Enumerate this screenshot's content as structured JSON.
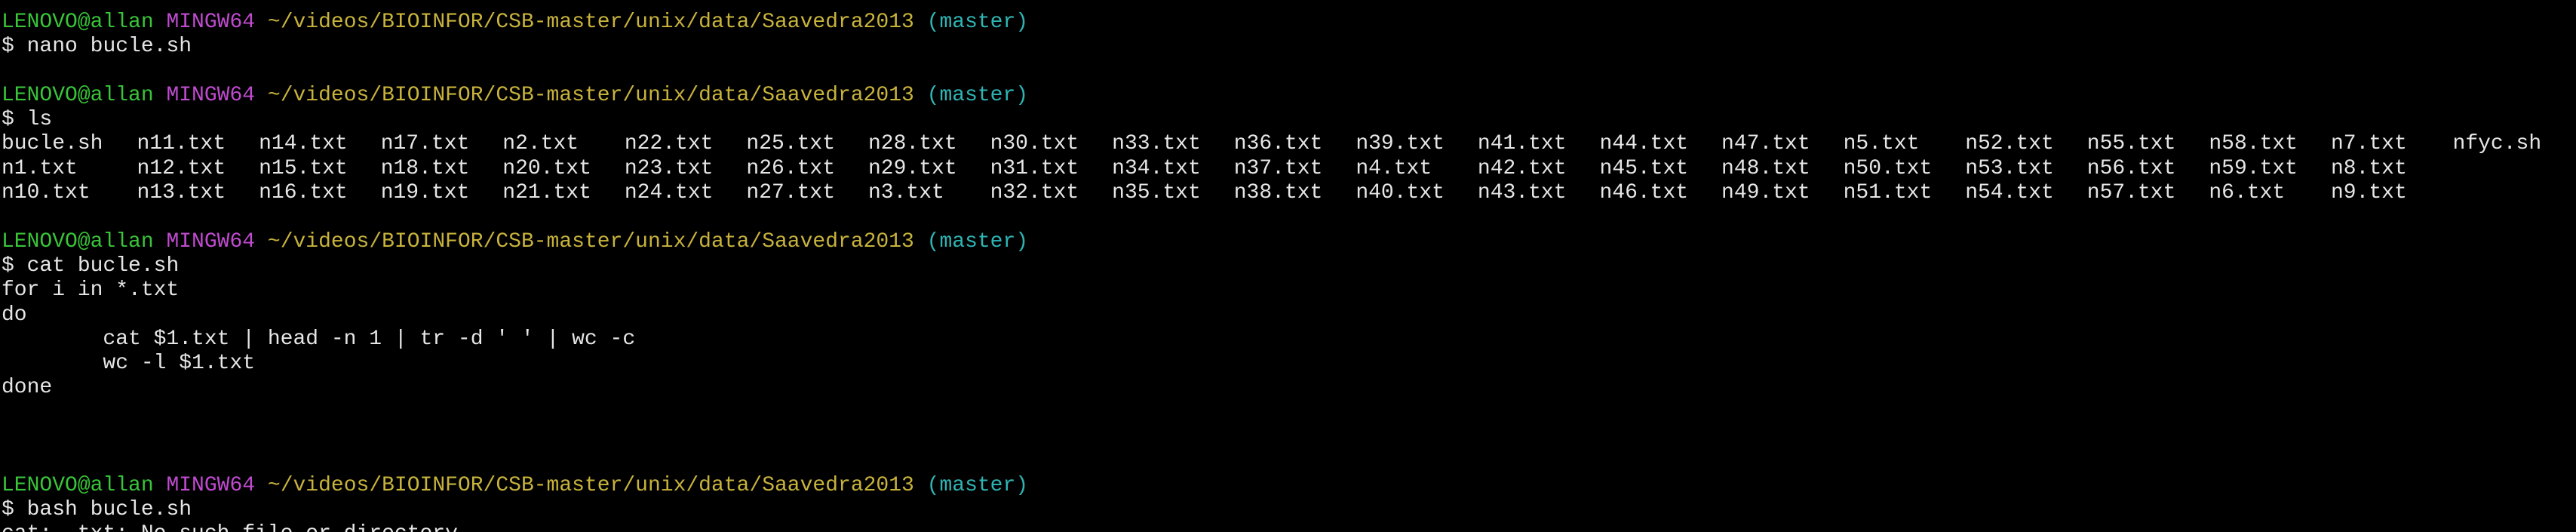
{
  "colors": {
    "background": "#000000",
    "text": "#e6e6e6",
    "user": "#39c43a",
    "system": "#c04bd0",
    "path": "#c8b33c",
    "branch": "#2fb4b4"
  },
  "prompt": {
    "user_host": "LENOVO@allan",
    "system": "MINGW64",
    "path": "~/videos/BIOINFOR/CSB-master/unix/data/Saavedra2013",
    "branch": "(master)",
    "symbol": "$"
  },
  "commands": {
    "nano": "nano bucle.sh",
    "ls": "ls",
    "cat": "cat bucle.sh",
    "bash": "bash bucle.sh"
  },
  "ls_output": [
    [
      "bucle.sh",
      "n11.txt",
      "n14.txt",
      "n17.txt",
      "n2.txt",
      "n22.txt",
      "n25.txt",
      "n28.txt",
      "n30.txt",
      "n33.txt",
      "n36.txt",
      "n39.txt",
      "n41.txt",
      "n44.txt",
      "n47.txt",
      "n5.txt",
      "n52.txt",
      "n55.txt",
      "n58.txt",
      "n7.txt",
      "nfyc.sh"
    ],
    [
      "n1.txt",
      "n12.txt",
      "n15.txt",
      "n18.txt",
      "n20.txt",
      "n23.txt",
      "n26.txt",
      "n29.txt",
      "n31.txt",
      "n34.txt",
      "n37.txt",
      "n4.txt",
      "n42.txt",
      "n45.txt",
      "n48.txt",
      "n50.txt",
      "n53.txt",
      "n56.txt",
      "n59.txt",
      "n8.txt",
      ""
    ],
    [
      "n10.txt",
      "n13.txt",
      "n16.txt",
      "n19.txt",
      "n21.txt",
      "n24.txt",
      "n27.txt",
      "n3.txt",
      "n32.txt",
      "n35.txt",
      "n38.txt",
      "n40.txt",
      "n43.txt",
      "n46.txt",
      "n49.txt",
      "n51.txt",
      "n54.txt",
      "n57.txt",
      "n6.txt",
      "n9.txt",
      ""
    ]
  ],
  "script_lines": [
    "for i in *.txt",
    "do",
    "        cat $1.txt | head -n 1 | tr -d ' ' | wc -c",
    "        wc -l $1.txt",
    "done"
  ],
  "error_partial": "cat: .txt: No such file or directory"
}
